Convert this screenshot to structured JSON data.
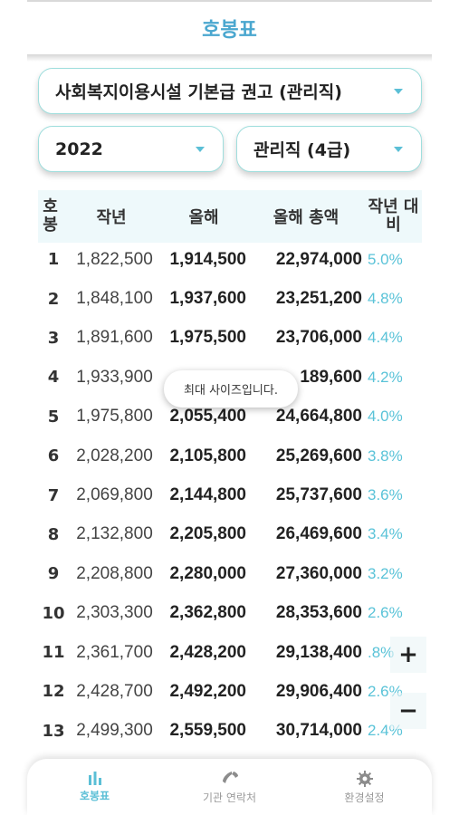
{
  "header": {
    "title": "호봉표"
  },
  "filters": {
    "facility": "사회복지이용시설 기본급 권고 (관리직)",
    "year": "2022",
    "rank": "관리직 (4급)"
  },
  "table": {
    "columns": {
      "step": "호봉",
      "prev": "작년",
      "current": "올해",
      "total": "올해 총액",
      "rate": "작년 대비"
    },
    "rows": [
      {
        "step": "1",
        "prev": "1,822,500",
        "current": "1,914,500",
        "total": "22,974,000",
        "rate": "5.0%"
      },
      {
        "step": "2",
        "prev": "1,848,100",
        "current": "1,937,600",
        "total": "23,251,200",
        "rate": "4.8%"
      },
      {
        "step": "3",
        "prev": "1,891,600",
        "current": "1,975,500",
        "total": "23,706,000",
        "rate": "4.4%"
      },
      {
        "step": "4",
        "prev": "1,933,900",
        "current": "",
        "total": "189,600",
        "rate": "4.2%"
      },
      {
        "step": "5",
        "prev": "1,975,800",
        "current": "2,055,400",
        "total": "24,664,800",
        "rate": "4.0%"
      },
      {
        "step": "6",
        "prev": "2,028,200",
        "current": "2,105,800",
        "total": "25,269,600",
        "rate": "3.8%"
      },
      {
        "step": "7",
        "prev": "2,069,800",
        "current": "2,144,800",
        "total": "25,737,600",
        "rate": "3.6%"
      },
      {
        "step": "8",
        "prev": "2,132,800",
        "current": "2,205,800",
        "total": "26,469,600",
        "rate": "3.4%"
      },
      {
        "step": "9",
        "prev": "2,208,800",
        "current": "2,280,000",
        "total": "27,360,000",
        "rate": "3.2%"
      },
      {
        "step": "10",
        "prev": "2,303,300",
        "current": "2,362,800",
        "total": "28,353,600",
        "rate": "2.6%"
      },
      {
        "step": "11",
        "prev": "2,361,700",
        "current": "2,428,200",
        "total": "29,138,400",
        "rate": ".8%"
      },
      {
        "step": "12",
        "prev": "2,428,700",
        "current": "2,492,200",
        "total": "29,906,400",
        "rate": "2.6%"
      },
      {
        "step": "13",
        "prev": "2,499,300",
        "current": "2,559,500",
        "total": "30,714,000",
        "rate": "2.4%"
      }
    ]
  },
  "toast": {
    "message": "최대 사이즈입니다."
  },
  "zoom": {
    "in_label": "+",
    "out_label": "−"
  },
  "nav": {
    "items": [
      {
        "label": "호봉표",
        "icon": "bar-chart-icon",
        "active": true
      },
      {
        "label": "기관 연락처",
        "icon": "phone-icon",
        "active": false
      },
      {
        "label": "환경설정",
        "icon": "gear-icon",
        "active": false
      }
    ]
  },
  "colors": {
    "accent": "#5bbfd6",
    "border": "#9fdedd",
    "header_bg": "#eef9fb"
  }
}
